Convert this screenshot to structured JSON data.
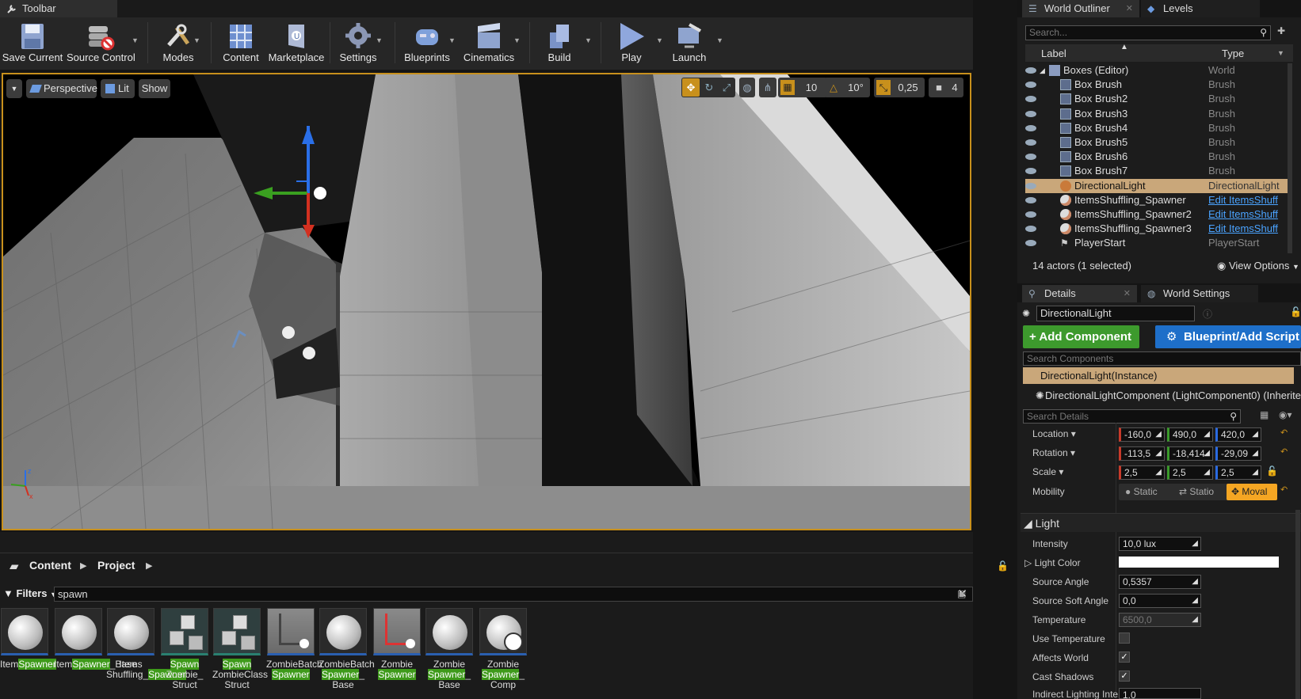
{
  "toolbar": {
    "tab_title": "Toolbar",
    "buttons": [
      {
        "label": "Save Current",
        "icon": "save-icon"
      },
      {
        "label": "Source Control",
        "icon": "source-control-icon"
      },
      {
        "label": "Modes",
        "icon": "modes-icon"
      },
      {
        "label": "Content",
        "icon": "content-icon"
      },
      {
        "label": "Marketplace",
        "icon": "marketplace-icon"
      },
      {
        "label": "Settings",
        "icon": "settings-icon"
      },
      {
        "label": "Blueprints",
        "icon": "blueprints-icon"
      },
      {
        "label": "Cinematics",
        "icon": "cinematics-icon"
      },
      {
        "label": "Build",
        "icon": "build-icon"
      },
      {
        "label": "Play",
        "icon": "play-icon"
      },
      {
        "label": "Launch",
        "icon": "launch-icon"
      }
    ]
  },
  "viewport": {
    "perspective_label": "Perspective",
    "lit_label": "Lit",
    "show_label": "Show",
    "grid_snap": "10",
    "rotation_snap": "10°",
    "scale_snap": "0,25",
    "camera_speed": "4"
  },
  "outliner": {
    "tab_outliner": "World Outliner",
    "tab_levels": "Levels",
    "search_placeholder": "Search...",
    "col_label": "Label",
    "col_type": "Type",
    "rows": [
      {
        "label": "Boxes (Editor)",
        "type": "World",
        "link": false,
        "selected": false
      },
      {
        "label": "Box Brush",
        "type": "Brush",
        "link": false,
        "selected": false
      },
      {
        "label": "Box Brush2",
        "type": "Brush",
        "link": false,
        "selected": false
      },
      {
        "label": "Box Brush3",
        "type": "Brush",
        "link": false,
        "selected": false
      },
      {
        "label": "Box Brush4",
        "type": "Brush",
        "link": false,
        "selected": false
      },
      {
        "label": "Box Brush5",
        "type": "Brush",
        "link": false,
        "selected": false
      },
      {
        "label": "Box Brush6",
        "type": "Brush",
        "link": false,
        "selected": false
      },
      {
        "label": "Box Brush7",
        "type": "Brush",
        "link": false,
        "selected": false
      },
      {
        "label": "DirectionalLight",
        "type": "DirectionalLight",
        "link": false,
        "selected": true
      },
      {
        "label": "ItemsShuffling_Spawner",
        "type": "Edit ItemsShuff",
        "link": true,
        "selected": false
      },
      {
        "label": "ItemsShuffling_Spawner2",
        "type": "Edit ItemsShuff",
        "link": true,
        "selected": false
      },
      {
        "label": "ItemsShuffling_Spawner3",
        "type": "Edit ItemsShuff",
        "link": true,
        "selected": false
      },
      {
        "label": "PlayerStart",
        "type": "PlayerStart",
        "link": false,
        "selected": false
      }
    ],
    "status": "14 actors (1 selected)",
    "view_options": "View Options"
  },
  "details": {
    "tab_details": "Details",
    "tab_world_settings": "World Settings",
    "actor_name": "DirectionalLight",
    "add_component": "+ Add Component",
    "blueprint_button": "Blueprint/Add Script",
    "search_components_placeholder": "Search Components",
    "instance_label": "DirectionalLight(Instance)",
    "component_label": "DirectionalLightComponent (LightComponent0) (Inherite",
    "search_details_placeholder": "Search Details",
    "location_label": "Location",
    "location": [
      "-160,0",
      "490,0",
      "420,0"
    ],
    "rotation_label": "Rotation",
    "rotation": [
      "-113,5",
      "-18,414",
      "-29,09"
    ],
    "scale_label": "Scale",
    "scale": [
      "2,5",
      "2,5",
      "2,5"
    ],
    "mobility_label": "Mobility",
    "mobility_static": "Static",
    "mobility_stationary": "Statio",
    "mobility_movable": "Moval",
    "light_section": "Light",
    "intensity_label": "Intensity",
    "intensity": "10,0 lux",
    "light_color_label": "Light Color",
    "source_angle_label": "Source Angle",
    "source_angle": "0,5357",
    "source_soft_angle_label": "Source Soft Angle",
    "source_soft_angle": "0,0",
    "temperature_label": "Temperature",
    "temperature": "6500,0",
    "use_temperature_label": "Use Temperature",
    "affects_world_label": "Affects World",
    "cast_shadows_label": "Cast Shadows",
    "indirect_label": "Indirect Lighting Inte",
    "indirect_value": "1,0"
  },
  "content_browser": {
    "crumb_content": "Content",
    "crumb_project": "Project",
    "filters_label": "Filters",
    "search_value": "spawn",
    "assets": [
      {
        "pre": "Item",
        "hl": "Spawner",
        "post": ""
      },
      {
        "pre": "Item",
        "hl": "Spawner",
        "post": "_Base"
      },
      {
        "pre": "Items Shuffling_",
        "hl": "Spawner",
        "post": ""
      },
      {
        "pre": "",
        "hl": "Spawn",
        "post": " Zombie_ Struct"
      },
      {
        "pre": "",
        "hl": "Spawn",
        "post": " ZombieClass Struct"
      },
      {
        "pre": "ZombieBatch ",
        "hl": "Spawner",
        "post": ""
      },
      {
        "pre": "ZombieBatch ",
        "hl": "Spawner",
        "post": "_ Base"
      },
      {
        "pre": "Zombie ",
        "hl": "Spawner",
        "post": ""
      },
      {
        "pre": "Zombie ",
        "hl": "Spawner",
        "post": "_ Base"
      },
      {
        "pre": "Zombie ",
        "hl": "Spawner",
        "post": "_ Comp"
      }
    ]
  },
  "colors": {
    "selection": "#c9a77a",
    "accent_orange": "#f5a623",
    "add_green": "#3d9a2d",
    "blueprint_blue": "#1e6fc9",
    "link_blue": "#4aa3ff"
  }
}
